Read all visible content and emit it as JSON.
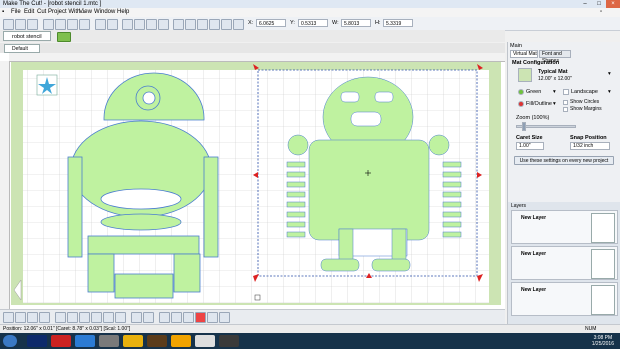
{
  "window": {
    "title": "Make The Cut! - [robot stencil 1.mtc ]"
  },
  "menu": [
    "File",
    "Edit",
    "Cut Project With...",
    "View",
    "Window",
    "Help"
  ],
  "toolbar": {
    "x_label": "X:",
    "x_value": "6.0625",
    "y_label": "Y:",
    "y_value": "0.5313",
    "w_label": "W:",
    "w_value": "5.8013",
    "h_label": "H:",
    "h_value": "5.3319"
  },
  "document_tab": "robot stencil 1.mtc *",
  "page_tab": "Default Page",
  "right_panel": {
    "tabs": [
      "Virtual Mat",
      "Font and Shapes"
    ],
    "header": "Main",
    "section_title": "Mat Configuration",
    "mat_name": "Typical Mat",
    "mat_size": "12.00\" x 12.00\"",
    "color_label": "Green",
    "orientation_label": "Landscape",
    "fill_label": "Fill/Outline",
    "show_circles": "Show Circles",
    "show_margins": "Show Margins",
    "zoom_label": "Zoom (100%)",
    "caret_label": "Caret Size",
    "caret_value": "1.00\"",
    "snap_label": "Snap Position",
    "snap_value": "1/32 inch",
    "apply_button": "Use these settings on every new project"
  },
  "layers": {
    "header": "Layers",
    "items": [
      {
        "name": "New Layer"
      },
      {
        "name": "New Layer"
      },
      {
        "name": "New Layer"
      }
    ]
  },
  "status": {
    "left": "Position: 12.06\" x 0.01\" [Caret: 8.78\" x 0.03\"] [Scal: 1.00\"]",
    "right": "NUM"
  },
  "clock": {
    "time": "3:08 PM",
    "date": "1/25/2016"
  },
  "colors": {
    "mat": "#cce4b3",
    "shape": "#bff2a0",
    "shape_outline": "#4a7dcf",
    "selection": "#2b4fa8",
    "taskbar": "#16324a"
  },
  "icons": [
    "new-icon",
    "open-icon",
    "save-icon",
    "cut-icon",
    "copy-icon",
    "paste-icon",
    "undo-icon",
    "redo-icon",
    "zoom-in-icon",
    "zoom-out-icon",
    "pan-icon",
    "refresh-icon",
    "align-icon"
  ]
}
